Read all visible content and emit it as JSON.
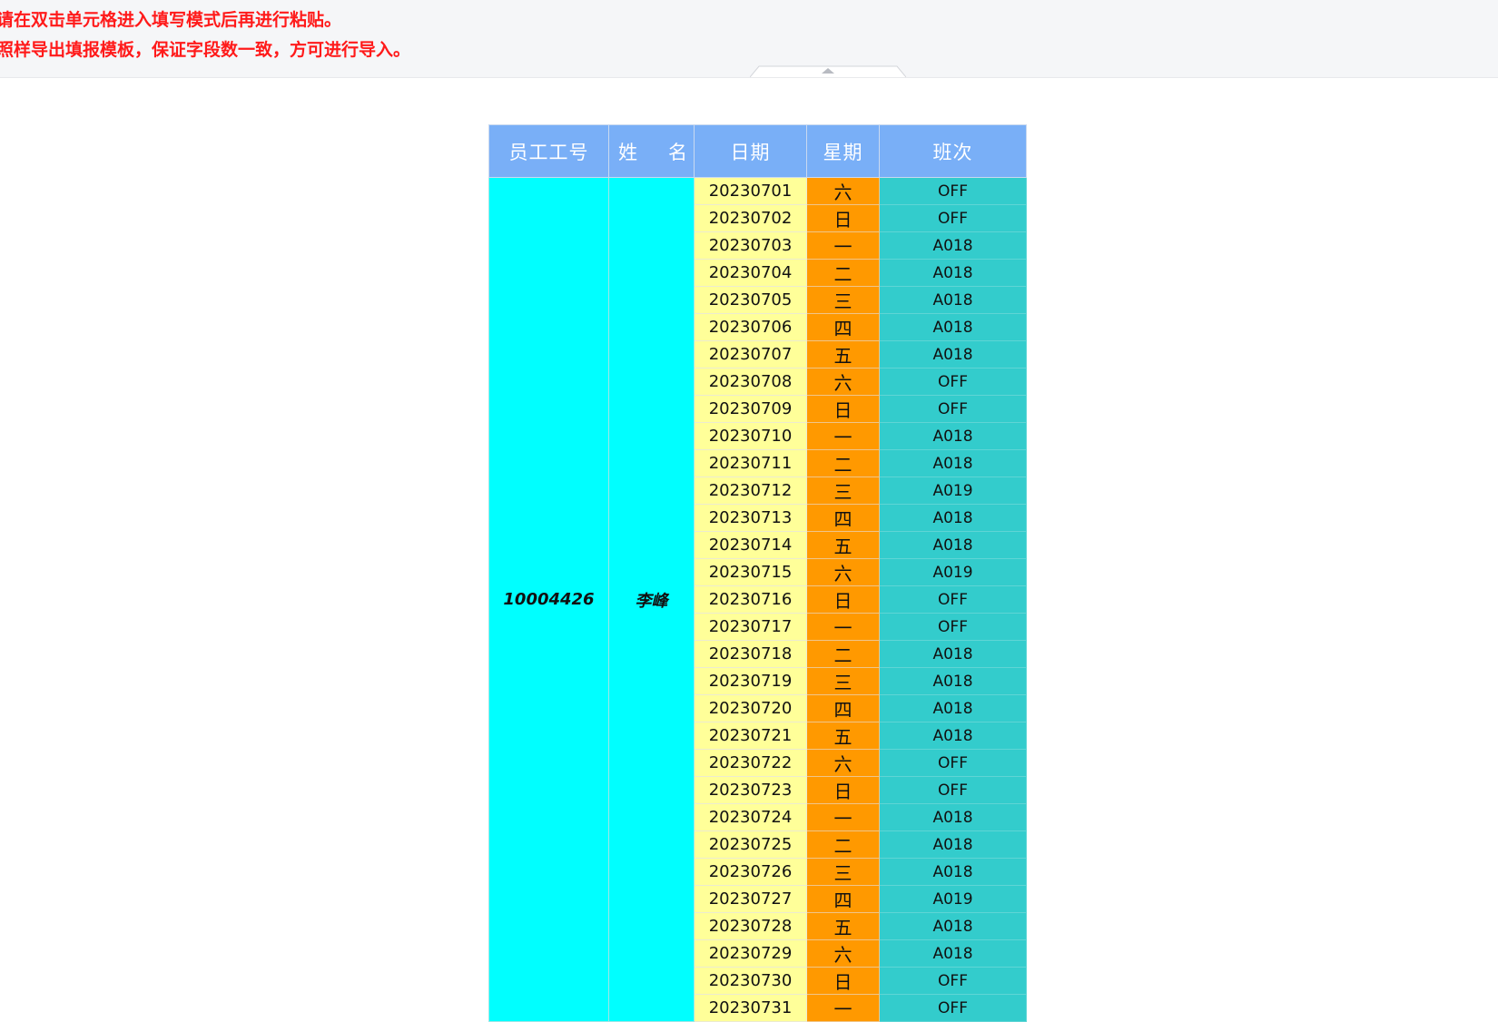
{
  "notice": {
    "line1": "请在双击单元格进入填写模式后再进行粘贴。",
    "line2": "照样导出填报模板，保证字段数一致，方可进行导入。"
  },
  "table": {
    "headers": {
      "employee_id": "员工工号",
      "name": "姓　名",
      "date": "日期",
      "weekday": "星期",
      "shift": "班次"
    },
    "employee_id": "10004426",
    "employee_name": "李峰",
    "rows": [
      {
        "date": "20230701",
        "weekday": "六",
        "shift": "OFF"
      },
      {
        "date": "20230702",
        "weekday": "日",
        "shift": "OFF"
      },
      {
        "date": "20230703",
        "weekday": "一",
        "shift": "A018"
      },
      {
        "date": "20230704",
        "weekday": "二",
        "shift": "A018"
      },
      {
        "date": "20230705",
        "weekday": "三",
        "shift": "A018"
      },
      {
        "date": "20230706",
        "weekday": "四",
        "shift": "A018"
      },
      {
        "date": "20230707",
        "weekday": "五",
        "shift": "A018"
      },
      {
        "date": "20230708",
        "weekday": "六",
        "shift": "OFF"
      },
      {
        "date": "20230709",
        "weekday": "日",
        "shift": "OFF"
      },
      {
        "date": "20230710",
        "weekday": "一",
        "shift": "A018"
      },
      {
        "date": "20230711",
        "weekday": "二",
        "shift": "A018"
      },
      {
        "date": "20230712",
        "weekday": "三",
        "shift": "A019"
      },
      {
        "date": "20230713",
        "weekday": "四",
        "shift": "A018"
      },
      {
        "date": "20230714",
        "weekday": "五",
        "shift": "A018"
      },
      {
        "date": "20230715",
        "weekday": "六",
        "shift": "A019"
      },
      {
        "date": "20230716",
        "weekday": "日",
        "shift": "OFF"
      },
      {
        "date": "20230717",
        "weekday": "一",
        "shift": "OFF"
      },
      {
        "date": "20230718",
        "weekday": "二",
        "shift": "A018"
      },
      {
        "date": "20230719",
        "weekday": "三",
        "shift": "A018"
      },
      {
        "date": "20230720",
        "weekday": "四",
        "shift": "A018"
      },
      {
        "date": "20230721",
        "weekday": "五",
        "shift": "A018"
      },
      {
        "date": "20230722",
        "weekday": "六",
        "shift": "OFF"
      },
      {
        "date": "20230723",
        "weekday": "日",
        "shift": "OFF"
      },
      {
        "date": "20230724",
        "weekday": "一",
        "shift": "A018"
      },
      {
        "date": "20230725",
        "weekday": "二",
        "shift": "A018"
      },
      {
        "date": "20230726",
        "weekday": "三",
        "shift": "A018"
      },
      {
        "date": "20230727",
        "weekday": "四",
        "shift": "A019"
      },
      {
        "date": "20230728",
        "weekday": "五",
        "shift": "A018"
      },
      {
        "date": "20230729",
        "weekday": "六",
        "shift": "A018"
      },
      {
        "date": "20230730",
        "weekday": "日",
        "shift": "OFF"
      },
      {
        "date": "20230731",
        "weekday": "一",
        "shift": "OFF"
      }
    ]
  },
  "colors": {
    "header_bg": "#79aff7",
    "id_name_bg": "#00ffff",
    "date_bg": "#ffff99",
    "weekday_bg": "#ff9900",
    "shift_bg": "#33cccc",
    "notice_text": "#ff1a1a"
  },
  "icons": {
    "collapse": "collapse-arrow-icon"
  }
}
